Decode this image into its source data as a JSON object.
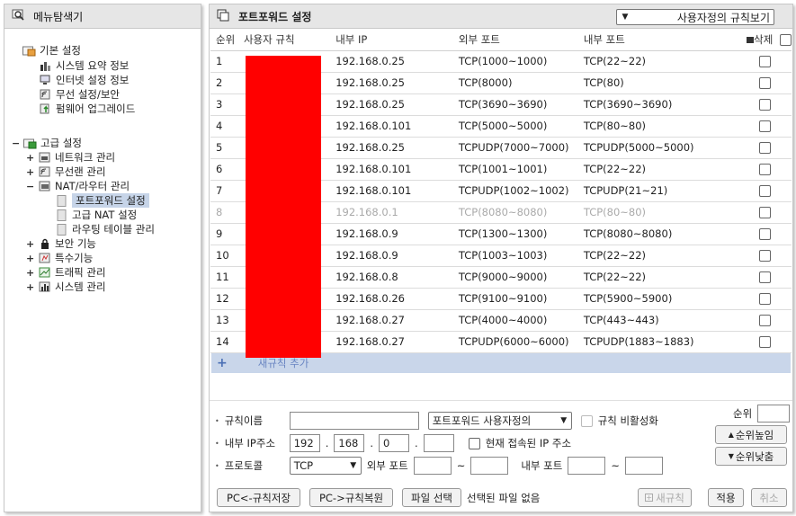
{
  "left": {
    "title": "메뉴탐색기",
    "basic": {
      "label": "기본 설정",
      "items": [
        "시스템 요약 정보",
        "인터넷 설정 정보",
        "무선 설정/보안",
        "펌웨어 업그레이드"
      ]
    },
    "advanced": {
      "label": "고급 설정",
      "items": [
        {
          "toggle": "+",
          "label": "네트워크 관리"
        },
        {
          "toggle": "+",
          "label": "무선랜 관리"
        },
        {
          "toggle": "−",
          "label": "NAT/라우터 관리"
        }
      ],
      "nat_children": [
        "포트포워드 설정",
        "고급 NAT 설정",
        "라우팅 테이블 관리"
      ],
      "more": [
        {
          "toggle": "+",
          "label": "보안 기능"
        },
        {
          "toggle": "+",
          "label": "특수기능"
        },
        {
          "toggle": "+",
          "label": "트래픽 관리"
        },
        {
          "toggle": "+",
          "label": "시스템 관리"
        }
      ]
    }
  },
  "right": {
    "title": "포트포워드 설정",
    "view_select": "사용자정의 규칙보기",
    "columns": [
      "순위",
      "사용자 규칙",
      "내부 IP",
      "외부 포트",
      "내부 포트",
      "삭제"
    ],
    "rows": [
      {
        "idx": "1",
        "ip": "192.168.0.25",
        "ext": "TCP(1000~1000)",
        "int": "TCP(22~22)"
      },
      {
        "idx": "2",
        "ip": "192.168.0.25",
        "ext": "TCP(8000)",
        "int": "TCP(80)"
      },
      {
        "idx": "3",
        "ip": "192.168.0.25",
        "ext": "TCP(3690~3690)",
        "int": "TCP(3690~3690)"
      },
      {
        "idx": "4",
        "ip": "192.168.0.101",
        "ext": "TCP(5000~5000)",
        "int": "TCP(80~80)"
      },
      {
        "idx": "5",
        "ip": "192.168.0.25",
        "ext": "TCPUDP(7000~7000)",
        "int": "TCPUDP(5000~5000)"
      },
      {
        "idx": "6",
        "ip": "192.168.0.101",
        "ext": "TCP(1001~1001)",
        "int": "TCP(22~22)"
      },
      {
        "idx": "7",
        "ip": "192.168.0.101",
        "ext": "TCPUDP(1002~1002)",
        "int": "TCPUDP(21~21)"
      },
      {
        "idx": "8",
        "ip": "192.168.0.1",
        "ext": "TCP(8080~8080)",
        "int": "TCP(80~80)",
        "disabled": true
      },
      {
        "idx": "9",
        "ip": "192.168.0.9",
        "ext": "TCP(1300~1300)",
        "int": "TCP(8080~8080)"
      },
      {
        "idx": "10",
        "ip": "192.168.0.9",
        "ext": "TCP(1003~1003)",
        "int": "TCP(22~22)"
      },
      {
        "idx": "11",
        "ip": "192.168.0.8",
        "ext": "TCP(9000~9000)",
        "int": "TCP(22~22)"
      },
      {
        "idx": "12",
        "ip": "192.168.0.26",
        "ext": "TCP(9100~9100)",
        "int": "TCP(5900~5900)"
      },
      {
        "idx": "13",
        "ip": "192.168.0.27",
        "ext": "TCP(4000~4000)",
        "int": "TCP(443~443)"
      },
      {
        "idx": "14",
        "ip": "192.168.0.27",
        "ext": "TCPUDP(6000~6000)",
        "int": "TCPUDP(1883~1883)"
      }
    ],
    "add_rule": "새규칙 추가",
    "form": {
      "rule_name_label": "규칙이름",
      "rule_type": "포트포워드 사용자정의",
      "disable_rule_label": "규칙 비활성화",
      "internal_ip_label": "내부 IP주소",
      "ip_parts": [
        "192",
        "168",
        "0",
        ""
      ],
      "current_ip_label": "현재 접속된 IP 주소",
      "protocol_label": "프로토콜",
      "protocol_value": "TCP",
      "external_port_label": "외부 포트",
      "tilde": "~",
      "internal_port_label": "내부 포트",
      "rank_label": "순위",
      "rank_up": "순위높임",
      "rank_down": "순위낮춤",
      "save_pc": "PC<-규칙저장",
      "restore_pc": "PC->규칙복원",
      "file_select": "파일 선택",
      "no_file": "선택된 파일 없음",
      "new_rule": "새규칙",
      "apply": "적용",
      "cancel": "취소"
    }
  }
}
